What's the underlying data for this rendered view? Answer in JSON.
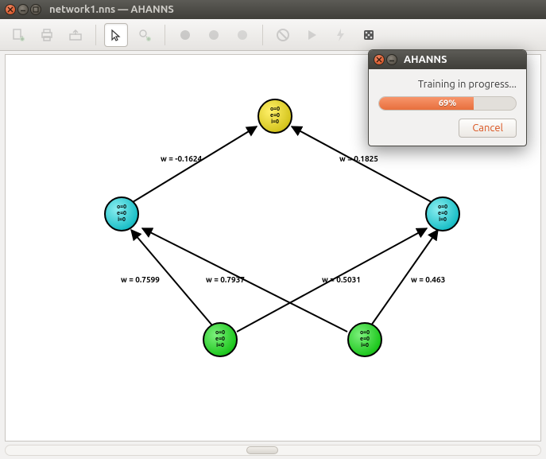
{
  "window": {
    "title": "network1.nns — AHANNS"
  },
  "toolbar_icons": {
    "add_doc": "add-document-icon",
    "print": "print-icon",
    "export": "export-icon",
    "cursor": "cursor-icon",
    "add_node": "add-node-icon",
    "dot1": "neuron-type-1-icon",
    "dot2": "neuron-type-2-icon",
    "dot3": "neuron-type-3-icon",
    "forbid": "no-entry-icon",
    "play": "play-icon",
    "lightning": "train-icon",
    "die": "randomize-icon"
  },
  "nodes": {
    "top": {
      "l1": "o=0",
      "l2": "e=0",
      "l3": "i=0"
    },
    "left": {
      "l1": "o=0",
      "l2": "e=0",
      "l3": "i=0"
    },
    "right": {
      "l1": "o=0",
      "l2": "e=0",
      "l3": "i=0"
    },
    "bleft": {
      "l1": "o=0",
      "l2": "e=0",
      "l3": "i=0"
    },
    "bright": {
      "l1": "o=0",
      "l2": "e=0",
      "l3": "i=0"
    }
  },
  "edges": {
    "w_lt": "w = -0.1624",
    "w_rt": "w = 0.1825",
    "w_bl_l": "w = 0.7599",
    "w_bl_r": "w = 0.7937",
    "w_br_l": "w = 0.5031",
    "w_br_r": "w = 0.463"
  },
  "dialog": {
    "title": "AHANNS",
    "message": "Training in progress...",
    "progress_percent": 69,
    "progress_text": "69%",
    "cancel": "Cancel"
  }
}
